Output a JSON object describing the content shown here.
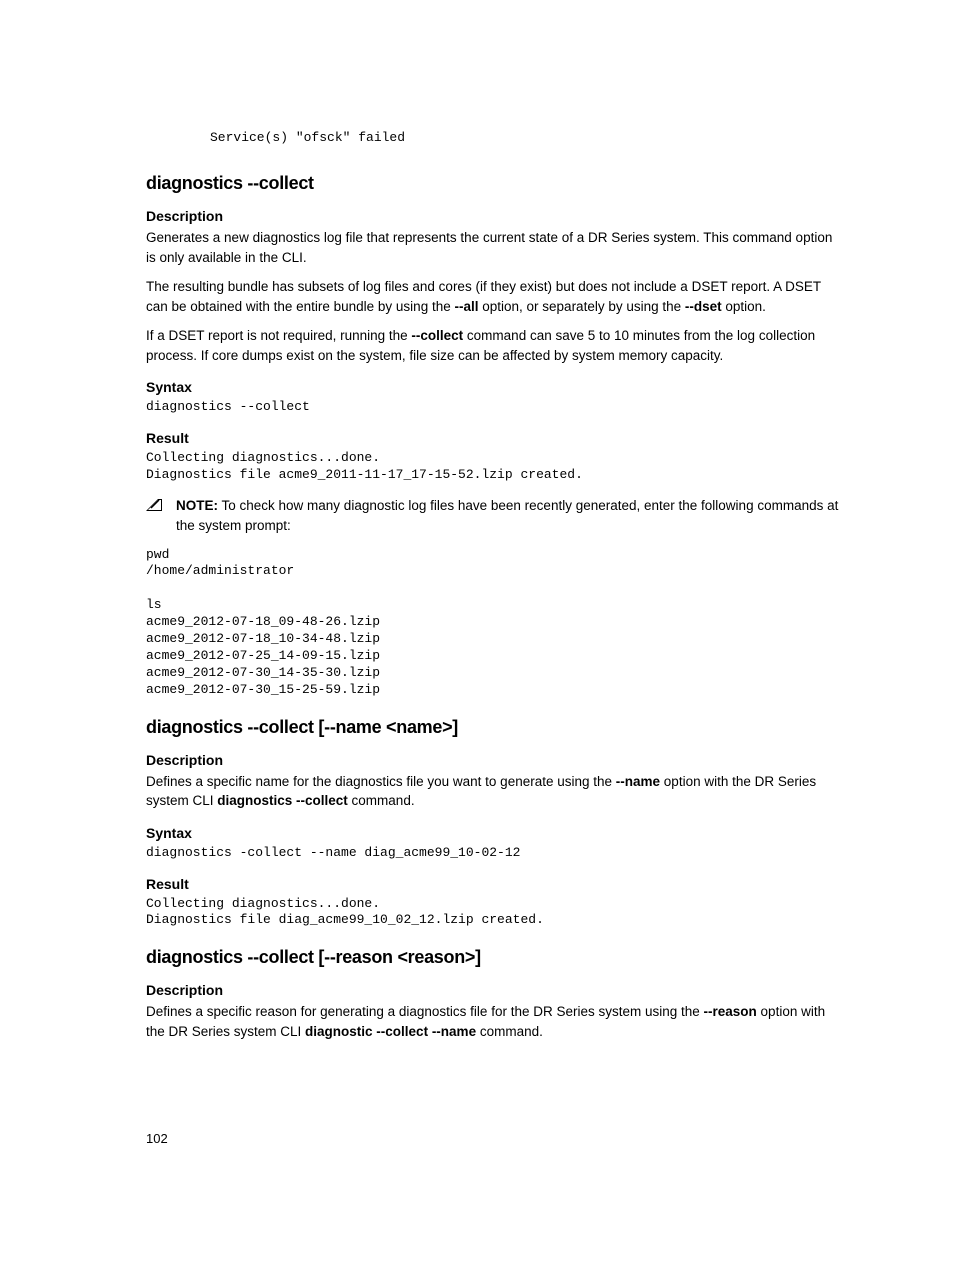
{
  "top_code": "Service(s) \"ofsck\" failed",
  "sec1": {
    "title": "diagnostics --collect",
    "desc_h": "Description",
    "desc_p1": "Generates a new diagnostics log file that represents the current state of a DR Series system. This command option is only available in the CLI.",
    "desc_p2a": "The resulting bundle has subsets of log files and cores (if they exist) but does not include a DSET report. A DSET can be obtained with the entire bundle by using the ",
    "desc_p2b": "--all",
    "desc_p2c": " option, or separately by using the ",
    "desc_p2d": "--dset",
    "desc_p2e": " option.",
    "desc_p3a": "If a DSET report is not required, running the ",
    "desc_p3b": "--collect",
    "desc_p3c": " command can save 5 to 10 minutes from the log collection process. If core dumps exist on the system, file size can be affected by system memory capacity.",
    "syntax_h": "Syntax",
    "syntax_code": "diagnostics --collect",
    "result_h": "Result",
    "result_code": "Collecting diagnostics...done.\nDiagnostics file acme9_2011-11-17_17-15-52.lzip created.",
    "note_label": "NOTE:",
    "note_text": " To check how many diagnostic log files have been recently generated, enter the following commands at the system prompt:",
    "ls_code": "pwd\n/home/administrator\n\nls\nacme9_2012-07-18_09-48-26.lzip\nacme9_2012-07-18_10-34-48.lzip\nacme9_2012-07-25_14-09-15.lzip\nacme9_2012-07-30_14-35-30.lzip\nacme9_2012-07-30_15-25-59.lzip"
  },
  "sec2": {
    "title": "diagnostics --collect [--name <name>]",
    "desc_h": "Description",
    "desc_pa": "Defines a specific name for the diagnostics file you want to generate using the ",
    "desc_pb": "--name",
    "desc_pc": " option with the DR Series system CLI ",
    "desc_pd": "diagnostics --collect",
    "desc_pe": " command.",
    "syntax_h": "Syntax",
    "syntax_code": "diagnostics -collect --name diag_acme99_10-02-12",
    "result_h": "Result",
    "result_code": "Collecting diagnostics...done.\nDiagnostics file diag_acme99_10_02_12.lzip created."
  },
  "sec3": {
    "title": "diagnostics --collect [--reason <reason>]",
    "desc_h": "Description",
    "desc_pa": "Defines a specific reason for generating a diagnostics file for the DR Series system using the ",
    "desc_pb": "--reason",
    "desc_pc": " option with the DR Series system CLI ",
    "desc_pd": "diagnostic --collect --name",
    "desc_pe": " command."
  },
  "page_number": "102"
}
